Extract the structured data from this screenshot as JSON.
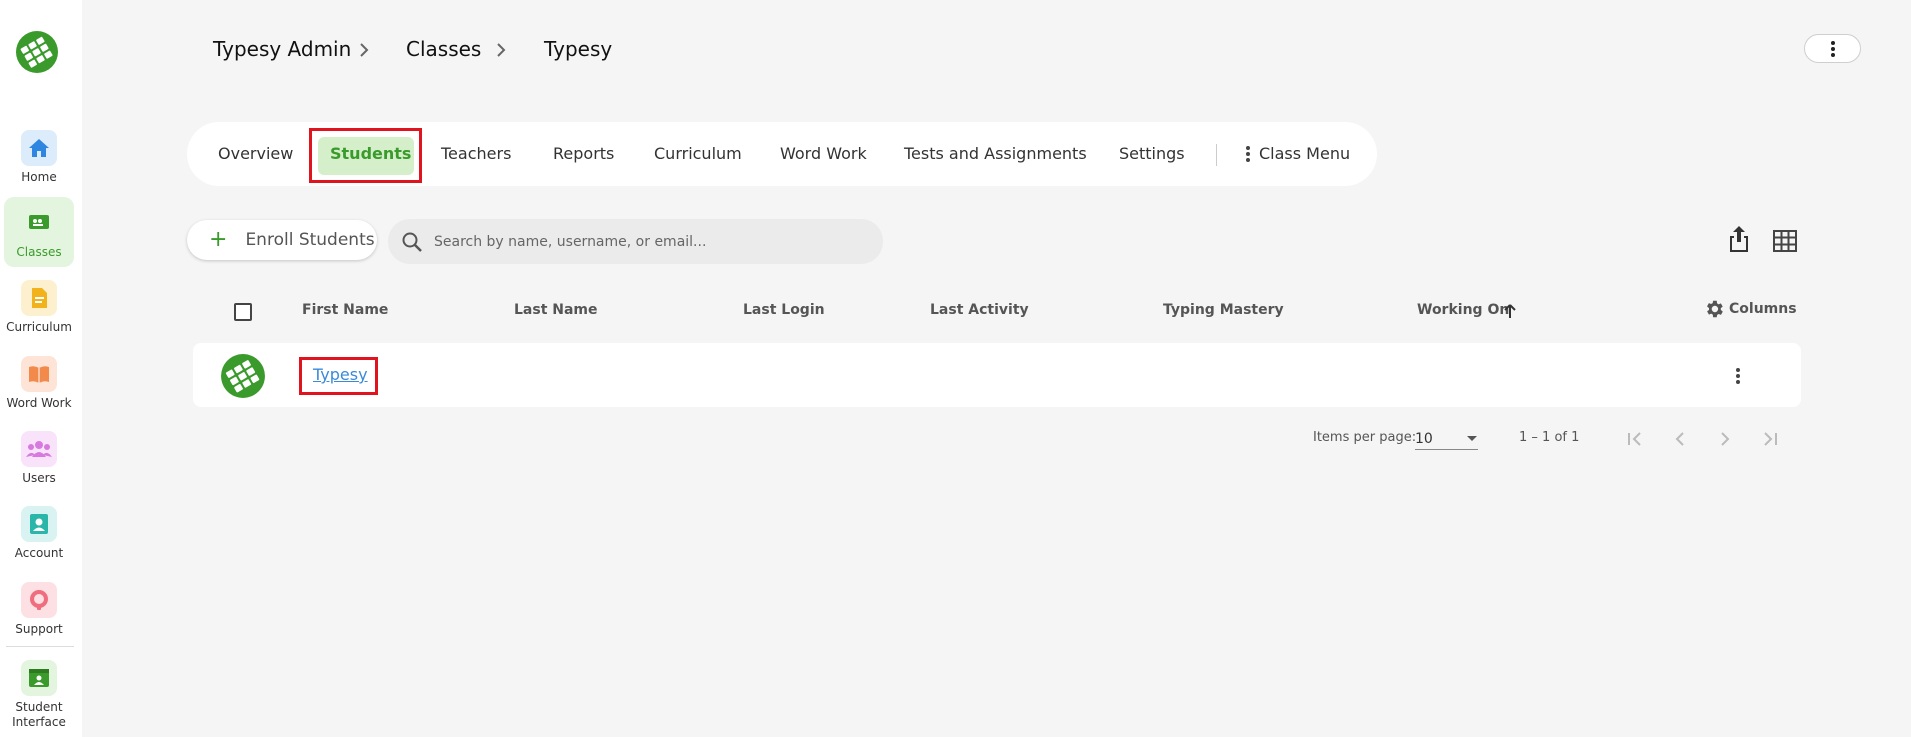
{
  "sidebar": {
    "items": [
      {
        "label": "Home",
        "icon": "home-icon",
        "color": "#2f86e0",
        "bg": "#dcecfb"
      },
      {
        "label": "Classes",
        "icon": "classes-icon",
        "color": "#3a9a2b",
        "bg": "#e3f5df",
        "active": true
      },
      {
        "label": "Curriculum",
        "icon": "curriculum-icon",
        "color": "#f2b21c",
        "bg": "#fdf0cf"
      },
      {
        "label": "Word Work",
        "icon": "book-icon",
        "color": "#f28a4b",
        "bg": "#fde4d6"
      },
      {
        "label": "Users",
        "icon": "users-icon",
        "color": "#d77ae0",
        "bg": "#f9e3fb"
      },
      {
        "label": "Account",
        "icon": "account-icon",
        "color": "#2ab6a9",
        "bg": "#d8f3f1"
      },
      {
        "label": "Support",
        "icon": "support-icon",
        "color": "#ef6d7d",
        "bg": "#fde0e4"
      },
      {
        "label_line1": "Student",
        "label_line2": "Interface",
        "icon": "student-interface-icon",
        "color": "#3a9a2b",
        "bg": "#e3f5df"
      }
    ]
  },
  "breadcrumb": {
    "items": [
      "Typesy Admin",
      "Classes",
      "Typesy"
    ]
  },
  "tabs": {
    "items": [
      "Overview",
      "Students",
      "Teachers",
      "Reports",
      "Curriculum",
      "Word Work",
      "Tests and Assignments",
      "Settings"
    ],
    "active": "Students",
    "class_menu": "Class Menu"
  },
  "toolbar": {
    "enroll_label": "Enroll Students",
    "search_placeholder": "Search by name, username, or email..."
  },
  "table": {
    "headers": [
      "First Name",
      "Last Name",
      "Last Login",
      "Last Activity",
      "Typing Mastery",
      "Working On"
    ],
    "columns_label": "Columns",
    "rows": [
      {
        "first_name": "Typesy",
        "last_name": "",
        "last_login": "",
        "last_activity": "",
        "typing_mastery": "",
        "working_on": ""
      }
    ]
  },
  "pagination": {
    "items_per_page_label": "Items per page:",
    "items_per_page": "10",
    "range": "1 – 1 of 1"
  },
  "colors": {
    "accent": "#3a9a2b",
    "highlight": "#e0141e",
    "link": "#3a8ad8"
  }
}
